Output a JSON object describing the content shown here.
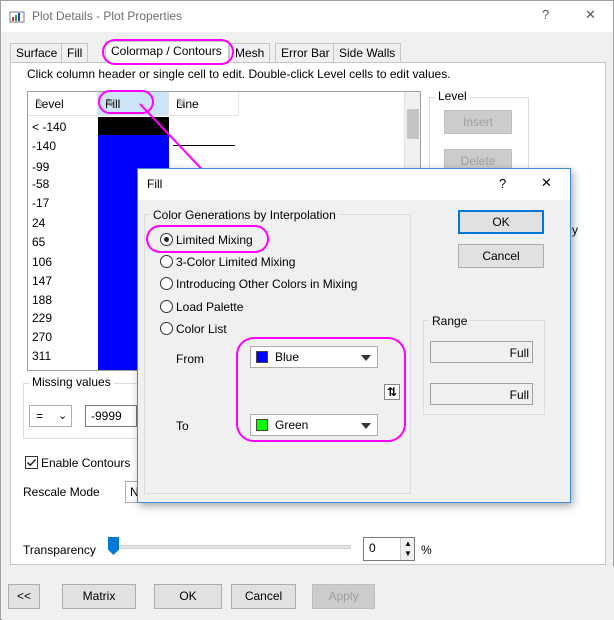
{
  "window": {
    "title": "Plot Details - Plot Properties",
    "help_glyph": "?",
    "close_glyph": "✕"
  },
  "tabs": [
    {
      "label": "Surface"
    },
    {
      "label": "Fill"
    },
    {
      "label": "Colormap / Contours"
    },
    {
      "label": "Mesh"
    },
    {
      "label": "Error Bar"
    },
    {
      "label": "Side Walls"
    }
  ],
  "hint": "Click column header or single cell to edit. Double-click Level cells to edit values.",
  "grid": {
    "columns": [
      "Level",
      "Fill",
      "Line"
    ],
    "levels": [
      "< -140",
      "-140",
      "-99",
      "-58",
      "-17",
      "24",
      "65",
      "106",
      "147",
      "188",
      "229",
      "270",
      "311"
    ]
  },
  "level_group": {
    "label": "Level",
    "insert": "Insert",
    "delete": "Delete",
    "partial_text": "y"
  },
  "missing_values": {
    "label": "Missing values",
    "operator": "=",
    "value": "-9999"
  },
  "enable_contours": "Enable Contours",
  "rescale_mode": {
    "label": "Rescale Mode",
    "value": "N"
  },
  "transparency": {
    "label": "Transparency",
    "value": "0",
    "unit": "%",
    "level_percent": 0
  },
  "bottom_buttons": {
    "back": "<<",
    "matrix": "Matrix",
    "ok": "OK",
    "cancel": "Cancel",
    "apply": "Apply"
  },
  "fill_dialog": {
    "title": "Fill",
    "help_glyph": "?",
    "close_glyph": "✕",
    "group_label": "Color Generations by Interpolation",
    "options": [
      {
        "label": "Limited Mixing",
        "selected": true
      },
      {
        "label": "3-Color Limited Mixing",
        "selected": false
      },
      {
        "label": "Introducing Other Colors in Mixing",
        "selected": false
      },
      {
        "label": "Load Palette",
        "selected": false
      },
      {
        "label": "Color List",
        "selected": false
      }
    ],
    "from_label": "From",
    "from_value": "Blue",
    "from_color": "#0000ff",
    "to_label": "To",
    "to_value": "Green",
    "to_color": "#00ff00",
    "swap_glyph": "⇅",
    "ok": "OK",
    "cancel": "Cancel",
    "range_label": "Range",
    "range_values": [
      "Full",
      "Full"
    ]
  },
  "colors": {
    "highlight": "#ff00ff",
    "fill_blue": "#0000ff",
    "selection": "#cce4f7",
    "accent": "#0078d7"
  }
}
